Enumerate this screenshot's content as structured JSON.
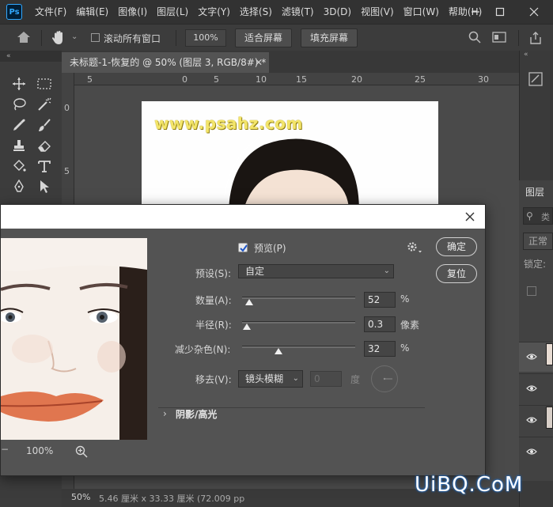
{
  "menubar": {
    "logo": "Ps",
    "items": [
      "文件(F)",
      "编辑(E)",
      "图像(I)",
      "图层(L)",
      "文字(Y)",
      "选择(S)",
      "滤镜(T)",
      "3D(D)",
      "视图(V)",
      "窗口(W)",
      "帮助(H)"
    ],
    "window_controls": [
      "minimize-icon",
      "restore-icon",
      "close-icon"
    ]
  },
  "options_bar": {
    "scroll_all_label": "滚动所有窗口",
    "zoom_value": "100%",
    "fit_screen": "适合屏幕",
    "fill_screen": "填充屏幕"
  },
  "document": {
    "tab_title": "未标题-1-恢复的 @ 50% (图层 3, RGB/8#) *",
    "watermark": "www.psahz.com",
    "ruler_h_labels": [
      "5",
      "0",
      "5",
      "10",
      "15",
      "20",
      "25",
      "30"
    ],
    "ruler_v_labels": [
      "0",
      "5"
    ]
  },
  "statusbar": {
    "zoom": "50%",
    "info": "5.46 厘米 x 33.33 厘米 (72.009 pp"
  },
  "right_panel": {
    "layers_tab": "图层",
    "search_placeholder": "类",
    "blend_mode": "正常",
    "lock_label": "锁定:"
  },
  "dialog": {
    "preview_label": "预览(P)",
    "preview_checked": true,
    "ok_button": "确定",
    "reset_button": "复位",
    "preset_label": "预设(S):",
    "preset_value": "自定",
    "amount_label": "数量(A):",
    "amount_value": "52",
    "amount_unit": "%",
    "amount_fraction": 0.52,
    "radius_label": "半径(R):",
    "radius_value": "0.3",
    "radius_unit": "像素",
    "reduce_noise_label": "减少杂色(N):",
    "reduce_noise_value": "32",
    "reduce_noise_unit": "%",
    "reduce_noise_fraction": 0.32,
    "remove_label": "移去(V):",
    "remove_value": "镜头模糊",
    "angle_value": "0",
    "angle_unit": "度",
    "shadows_label": "阴影/高光",
    "zoom_value": "100%"
  },
  "site_watermark": "UiBQ.CoM"
}
